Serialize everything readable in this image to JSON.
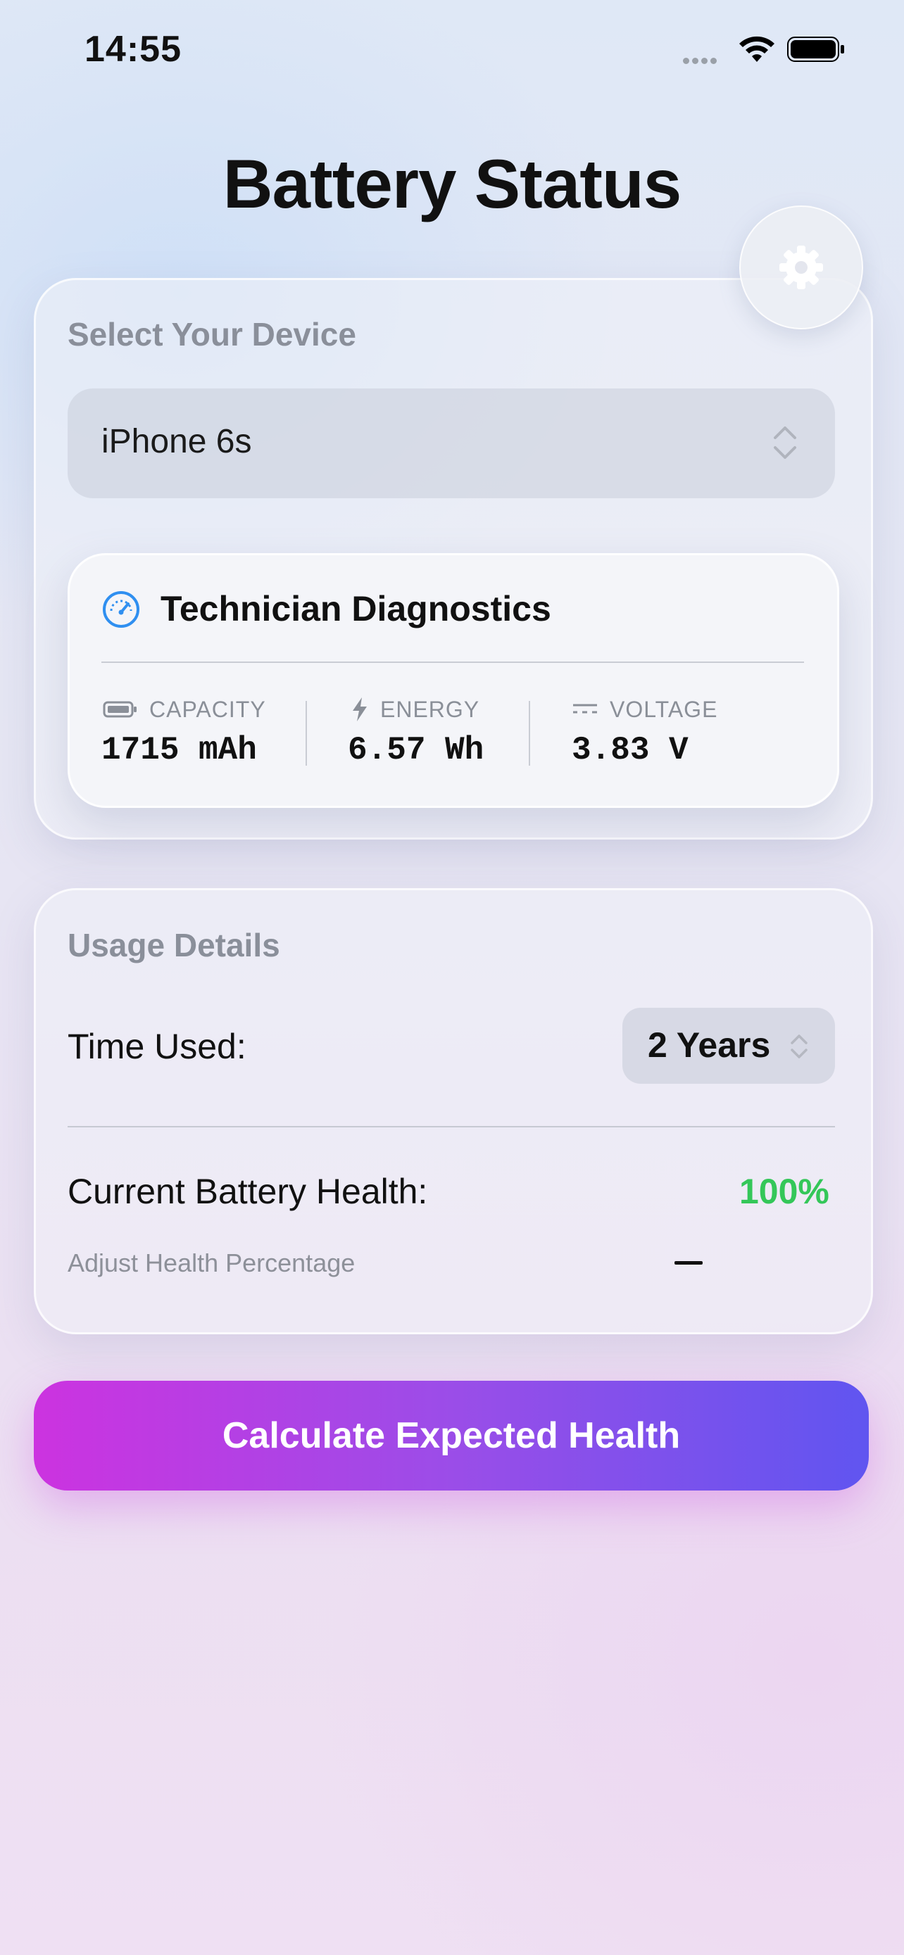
{
  "status_bar": {
    "time": "14:55"
  },
  "page": {
    "title": "Battery Status"
  },
  "device_section": {
    "label": "Select Your Device",
    "selected_device": "iPhone 6s"
  },
  "diagnostics": {
    "title": "Technician Diagnostics",
    "metrics": [
      {
        "label": "CAPACITY",
        "value": "1715 mAh",
        "icon": "battery-icon"
      },
      {
        "label": "ENERGY",
        "value": "6.57 Wh",
        "icon": "bolt-icon"
      },
      {
        "label": "VOLTAGE",
        "value": "3.83 V",
        "icon": "dc-voltage-icon"
      }
    ]
  },
  "usage": {
    "label": "Usage Details",
    "time_used_label": "Time Used:",
    "time_used_value": "2 Years",
    "health_label": "Current Battery Health:",
    "health_value": "100%",
    "adjust_label": "Adjust Health Percentage"
  },
  "cta": {
    "label": "Calculate Expected Health"
  },
  "colors": {
    "accent_green": "#34c759",
    "cta_start": "#cc33e0",
    "cta_end": "#6055f0",
    "diag_icon": "#2f8ff0"
  }
}
